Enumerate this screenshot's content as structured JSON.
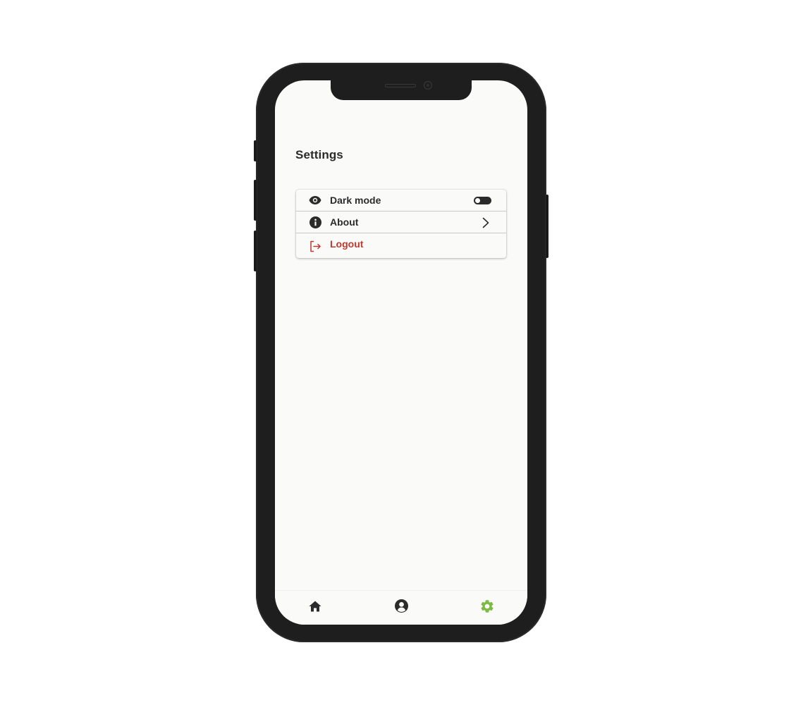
{
  "page": {
    "title": "Settings"
  },
  "settings": {
    "items": [
      {
        "label": "Dark mode",
        "icon": "eye-icon",
        "control": "toggle",
        "toggle_on": false
      },
      {
        "label": "About",
        "icon": "info-icon",
        "control": "chevron"
      },
      {
        "label": "Logout",
        "icon": "logout-icon",
        "control": "none",
        "color": "#c0392f"
      }
    ]
  },
  "tabbar": {
    "tabs": [
      {
        "icon": "home-icon",
        "active": false
      },
      {
        "icon": "profile-icon",
        "active": false
      },
      {
        "icon": "gear-icon",
        "active": true
      }
    ],
    "active_color": "#7cba43",
    "inactive_color": "#2b2b2b"
  }
}
